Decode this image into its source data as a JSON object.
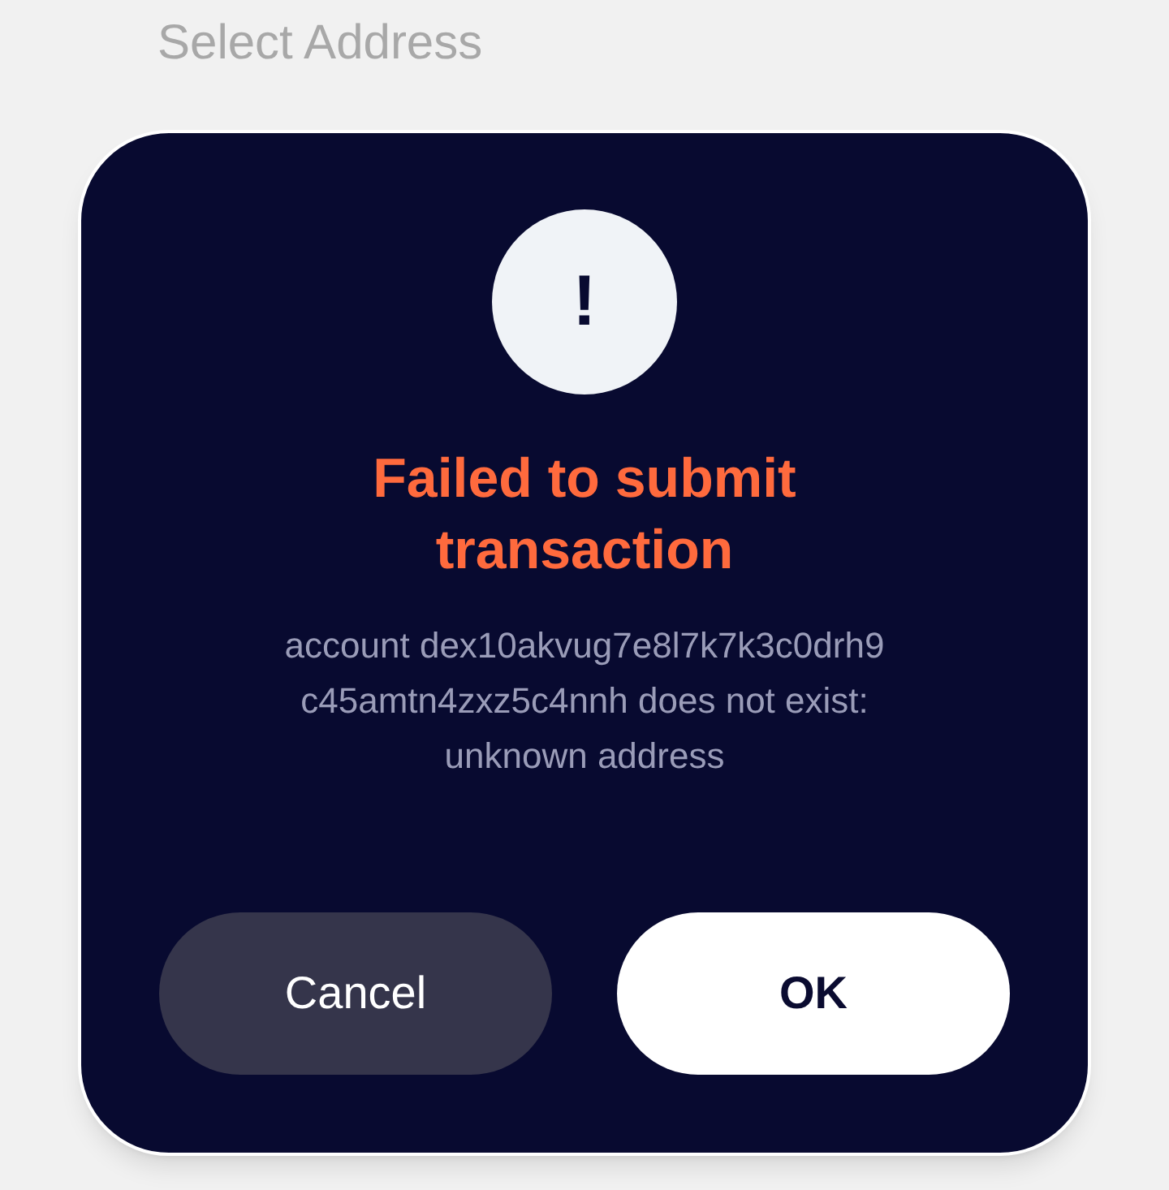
{
  "background": {
    "title": "Select Address"
  },
  "dialog": {
    "icon_glyph": "!",
    "title": "Failed to submit transaction",
    "message": "account dex10akvug7e8l7k7k3c0drh9 c45amtn4zxz5c4nnh does not exist: unknown address",
    "buttons": [
      {
        "label": "Cancel",
        "kind": "secondary"
      },
      {
        "label": "OK",
        "kind": "primary"
      }
    ]
  }
}
